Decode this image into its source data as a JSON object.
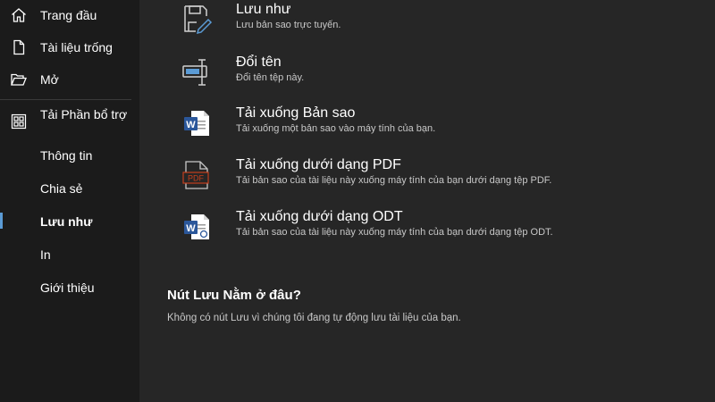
{
  "sidebar": {
    "items": [
      {
        "label": "Trang đầu",
        "icon": "home-icon"
      },
      {
        "label": "Tài liệu trống",
        "icon": "blank-document-icon"
      },
      {
        "label": "Mở",
        "icon": "folder-open-icon"
      },
      {
        "label": "Tải Phần bổ trợ",
        "icon": "addins-grid-icon"
      },
      {
        "label": "Thông tin"
      },
      {
        "label": "Chia sẻ"
      },
      {
        "label": "Lưu như",
        "active": true
      },
      {
        "label": "In"
      },
      {
        "label": "Giới thiệu"
      }
    ]
  },
  "main": {
    "options": [
      {
        "title": "Lưu như",
        "desc": "Lưu bản sao trực tuyến.",
        "icon": "save-as-icon"
      },
      {
        "title": "Đổi tên",
        "desc": "Đổi tên tệp này.",
        "icon": "rename-icon"
      },
      {
        "title": "Tải xuống Bản sao",
        "desc": "Tải xuống một bản sao vào máy tính của bạn.",
        "icon": "word-document-icon"
      },
      {
        "title": "Tải xuống dưới dạng PDF",
        "desc": "Tải bản sao của tài liệu này xuống máy tính của bạn dưới dạng tệp PDF.",
        "icon": "pdf-icon",
        "icon_text": "PDF"
      },
      {
        "title": "Tải xuống dưới dạng ODT",
        "desc": "Tải bản sao của tài liệu này xuống máy tính của bạn dưới dạng tệp ODT.",
        "icon": "odt-document-icon"
      }
    ],
    "section": {
      "heading": "Nút Lưu Nằm ở đâu?",
      "text": "Không có nút Lưu vì chúng tôi đang tự động lưu tài liệu của bạn."
    }
  },
  "colors": {
    "sidebar_bg": "#1b1b1b",
    "main_bg": "#262626",
    "accent": "#5b9bd5",
    "word_blue": "#2b579a",
    "pdf_red": "#c43e1c"
  }
}
